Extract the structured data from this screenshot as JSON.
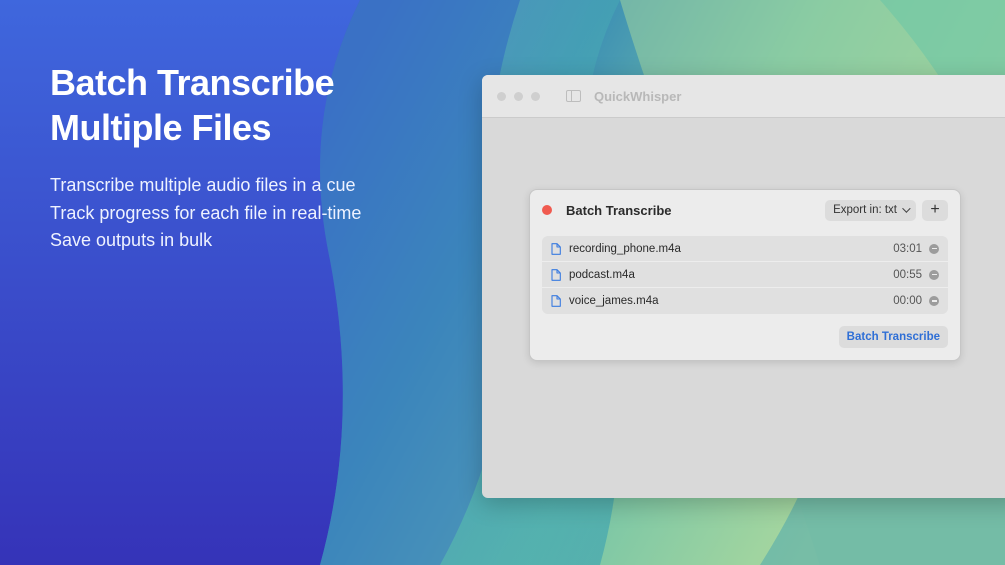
{
  "hero": {
    "title": "Batch Transcribe\nMultiple Files",
    "features": [
      "Transcribe multiple audio files in a cue",
      "Track progress for each file in real-time",
      "Save outputs in bulk"
    ]
  },
  "window": {
    "app_title": "QuickWhisper"
  },
  "dialog": {
    "title": "Batch Transcribe",
    "export_label": "Export in: txt",
    "add_label": "+",
    "files": [
      {
        "name": "recording_phone.m4a",
        "duration": "03:01"
      },
      {
        "name": "podcast.m4a",
        "duration": "00:55"
      },
      {
        "name": "voice_james.m4a",
        "duration": "00:00"
      }
    ],
    "batch_button_label": "Batch Transcribe"
  },
  "colors": {
    "accent": "#2f6fd6",
    "close": "#f05a4f"
  }
}
